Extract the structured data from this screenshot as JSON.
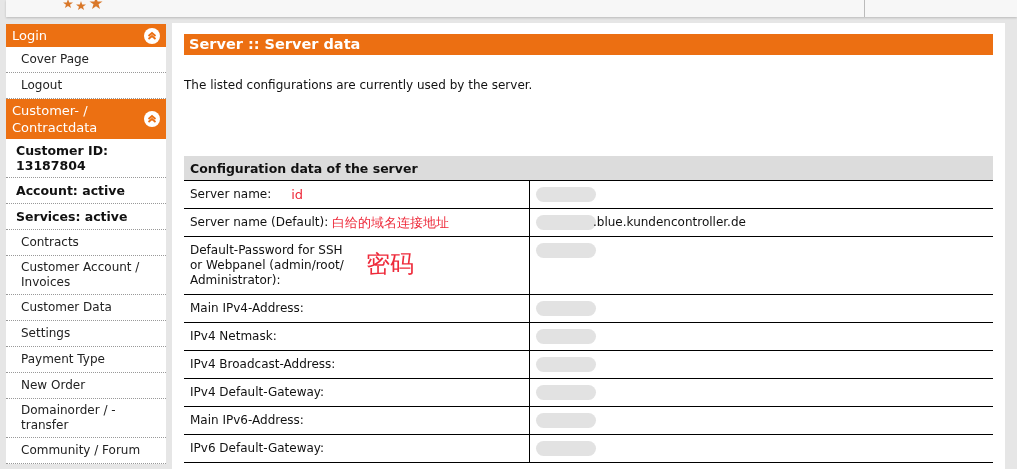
{
  "sidebar": {
    "sections": [
      {
        "title": "Login",
        "expanded": true,
        "items": [
          {
            "kind": "link",
            "label": "Cover Page"
          },
          {
            "kind": "link",
            "label": "Logout"
          }
        ]
      },
      {
        "title": "Customer- / Contractdata",
        "expanded": true,
        "items": [
          {
            "kind": "info",
            "label": "Customer ID: 13187804"
          },
          {
            "kind": "info",
            "label": "Account: active"
          },
          {
            "kind": "info",
            "label": "Services: active"
          },
          {
            "kind": "link",
            "label": "Contracts"
          },
          {
            "kind": "link",
            "label": "Customer Account / Invoices"
          },
          {
            "kind": "link",
            "label": "Customer Data"
          },
          {
            "kind": "link",
            "label": "Settings"
          },
          {
            "kind": "link",
            "label": "Payment Type"
          },
          {
            "kind": "link",
            "label": "New Order"
          },
          {
            "kind": "link",
            "label": "Domainorder / -transfer"
          },
          {
            "kind": "link",
            "label": "Community / Forum"
          }
        ]
      }
    ]
  },
  "main": {
    "title": "Server :: Server data",
    "intro": "The listed configurations are currently used by the server.",
    "table": {
      "heading": "Configuration data of the server",
      "rows": [
        {
          "label": "Server name:",
          "annotation": "id",
          "redacted": true
        },
        {
          "label": "Server name (Default):",
          "annotation": "白给的域名连接地址",
          "value": ".blue.kundencontroller.de",
          "redacted": true
        },
        {
          "label": "Default-Password for SSH or Webpanel (admin/root/ Administrator):",
          "annotation": "密码",
          "redacted": true
        },
        {
          "label": "Main IPv4-Address:",
          "redacted": true
        },
        {
          "label": "IPv4 Netmask:",
          "redacted": true
        },
        {
          "label": "IPv4 Broadcast-Address:",
          "redacted": true
        },
        {
          "label": "IPv4 Default-Gateway:",
          "redacted": true
        },
        {
          "label": "Main IPv6-Address:",
          "redacted": true
        },
        {
          "label": "IPv6 Default-Gateway:",
          "redacted": true
        }
      ]
    }
  }
}
